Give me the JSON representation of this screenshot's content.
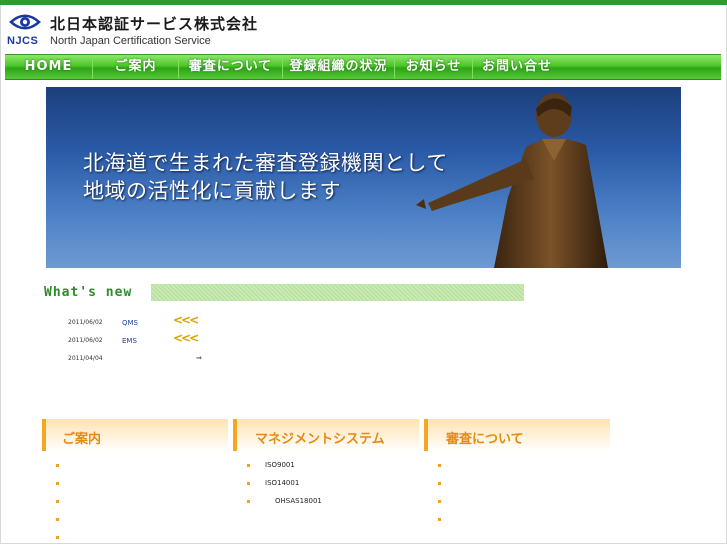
{
  "header": {
    "logo_text": "NJCS",
    "company_jp": "北日本認証サービス株式会社",
    "company_en": "North Japan Certification Service"
  },
  "nav": {
    "items": [
      {
        "label": "HOME"
      },
      {
        "label": "ご案内"
      },
      {
        "label": "審査について"
      },
      {
        "label": "登録組織の状況"
      },
      {
        "label": "お知らせ"
      },
      {
        "label": "お問い合せ"
      }
    ]
  },
  "hero": {
    "line1": "北海道で生まれた審査登録機関として",
    "line2": "地域の活性化に貢献します"
  },
  "whats_new": {
    "title": "What's new",
    "items": [
      {
        "date": "2011/06/02",
        "category": "QMS",
        "arrow": "<<<"
      },
      {
        "date": "2011/06/02",
        "category": "EMS",
        "arrow": "<<<"
      },
      {
        "date": "2011/04/04",
        "category": "",
        "arrow": "⇒"
      }
    ]
  },
  "sections": [
    {
      "title": "ご案内",
      "items": [
        "",
        "",
        "",
        "",
        ""
      ]
    },
    {
      "title": "マネジメントシステム",
      "items": [
        "ISO9001",
        "ISO14001",
        "OHSAS18001"
      ]
    },
    {
      "title": "審査について",
      "items": [
        "",
        "",
        "",
        ""
      ]
    }
  ],
  "colors": {
    "nav_green": "#4dc52a",
    "accent_orange": "#e38b12",
    "whats_new_green": "#2f8a2a",
    "news_blue": "#1f3f9f"
  }
}
